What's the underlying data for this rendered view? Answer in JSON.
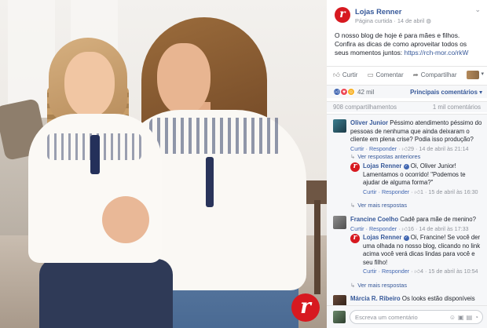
{
  "photo": {
    "logo_letter": "r"
  },
  "post": {
    "page_name": "Lojas Renner",
    "meta": "Página curtida · 14 de abril",
    "globe_icon": "globe-icon",
    "menu_icon": "chevron-down-icon",
    "text": "O nosso blog de hoje é para mães e filhos. Confira as dicas de como aproveitar todos os seus momentos juntos:",
    "link": "https://rch-mor.co/rkW"
  },
  "actions": {
    "like": "Curtir",
    "comment": "Comentar",
    "share": "Compartilhar"
  },
  "reactions": {
    "count": "42 mil",
    "sort": "Principais comentários ▾"
  },
  "shares": {
    "left": "908 compartilhamentos",
    "right": "1 mil comentários"
  },
  "comments": [
    {
      "name": "Oliver Junior",
      "text": "Péssimo atendimento péssimo do pessoas de nenhuma que ainda deixaram o cliente em plena crise? Podia isso produção?",
      "meta_reply": "Curtir · Responder",
      "likes": "29",
      "time": "14 de abril às 21:14"
    },
    {
      "more": "Ver respostas anteriores"
    },
    {
      "name": "Lojas Renner",
      "text": "Oi, Oliver Junior! Lamentamos o ocorrido! \"Podemos te ajudar de alguma forma?\"",
      "meta_reply": "Curtir · Responder",
      "likes": "1",
      "time": "15 de abril às 16:30"
    },
    {
      "more": "Ver mais respostas"
    },
    {
      "name": "Francine Coelho",
      "text": "Cadê para mãe de menino?",
      "meta_reply": "Curtir · Responder",
      "likes": "16",
      "time": "14 de abril às 17:33"
    },
    {
      "name": "Lojas Renner",
      "text": "Oi, Francine! Se você der uma olhada no nosso blog, clicando no link acima você verá dicas lindas para você e seu filho!",
      "meta_reply": "Curtir · Responder",
      "likes": "4",
      "time": "15 de abril às 10:54"
    },
    {
      "more": "Ver mais respostas"
    },
    {
      "name": "Márcia R. Ribeiro",
      "text": "Os looks estão disponíveis nas"
    }
  ],
  "composer": {
    "placeholder": "Escreva um comentário"
  },
  "colors": {
    "brand_red": "#d71920",
    "link_blue": "#365899"
  }
}
